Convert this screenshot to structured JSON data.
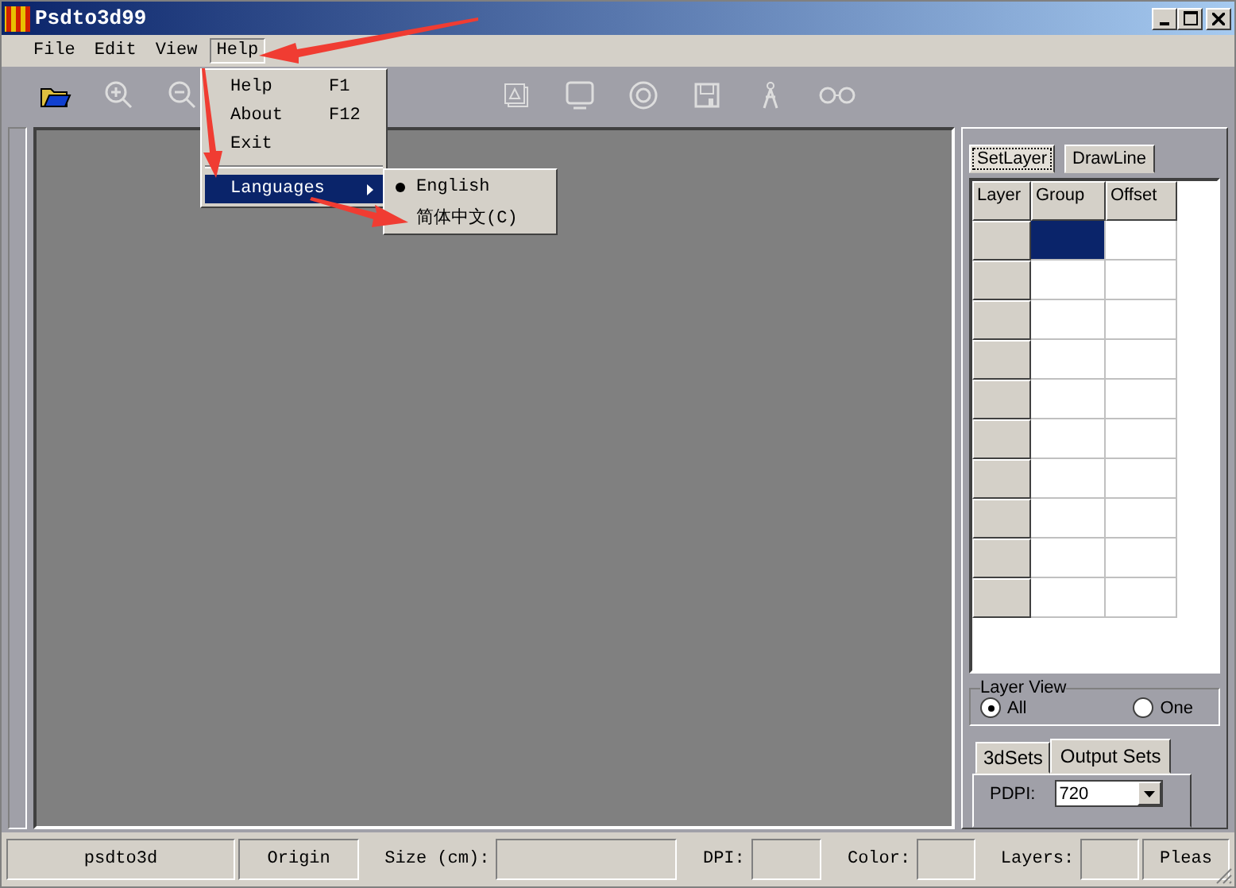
{
  "window": {
    "title": "Psdto3d99"
  },
  "menubar": [
    {
      "label": "File",
      "selected": false
    },
    {
      "label": "Edit",
      "selected": false
    },
    {
      "label": "View",
      "selected": false
    },
    {
      "label": "Help",
      "selected": true
    }
  ],
  "help_menu": [
    {
      "kind": "item",
      "label": "Help",
      "shortcut": "F1",
      "selected": false
    },
    {
      "kind": "item",
      "label": "About",
      "shortcut": "F12",
      "selected": false
    },
    {
      "kind": "item",
      "label": "Exit",
      "selected": false
    },
    {
      "kind": "separator"
    },
    {
      "kind": "submenu",
      "label": "Languages",
      "selected": true
    }
  ],
  "languages_menu": [
    {
      "label": "English",
      "checked": true
    },
    {
      "label": "简体中文(C)",
      "checked": false
    }
  ],
  "side_tabs": [
    {
      "label": "SetLayer",
      "selected": true
    },
    {
      "label": "DrawLine",
      "selected": false
    }
  ],
  "layer_table": {
    "columns": [
      "Layer",
      "Group",
      "Offset"
    ],
    "rows": [
      {
        "selected": true
      },
      {
        "selected": false
      },
      {
        "selected": false
      },
      {
        "selected": false
      },
      {
        "selected": false
      },
      {
        "selected": false
      },
      {
        "selected": false
      },
      {
        "selected": false
      },
      {
        "selected": false
      },
      {
        "selected": false
      }
    ]
  },
  "layer_view": {
    "title": "Layer View",
    "options": [
      {
        "label": "All",
        "selected": true
      },
      {
        "label": "One",
        "selected": false
      }
    ]
  },
  "bottom_tabs": [
    {
      "label": "3dSets",
      "selected": false
    },
    {
      "label": "Output Sets",
      "selected": true
    }
  ],
  "output_sets": {
    "label": "PDPI:",
    "value": "720"
  },
  "status_bar": [
    {
      "kind": "panel",
      "text": "psdto3d"
    },
    {
      "kind": "panel",
      "text": "Origin"
    },
    {
      "kind": "field",
      "label": "Size (cm):"
    },
    {
      "kind": "field",
      "label": "DPI:"
    },
    {
      "kind": "field",
      "label": "Color:"
    },
    {
      "kind": "field",
      "label": "Layers:"
    },
    {
      "kind": "panel",
      "text": "Pleas"
    }
  ]
}
